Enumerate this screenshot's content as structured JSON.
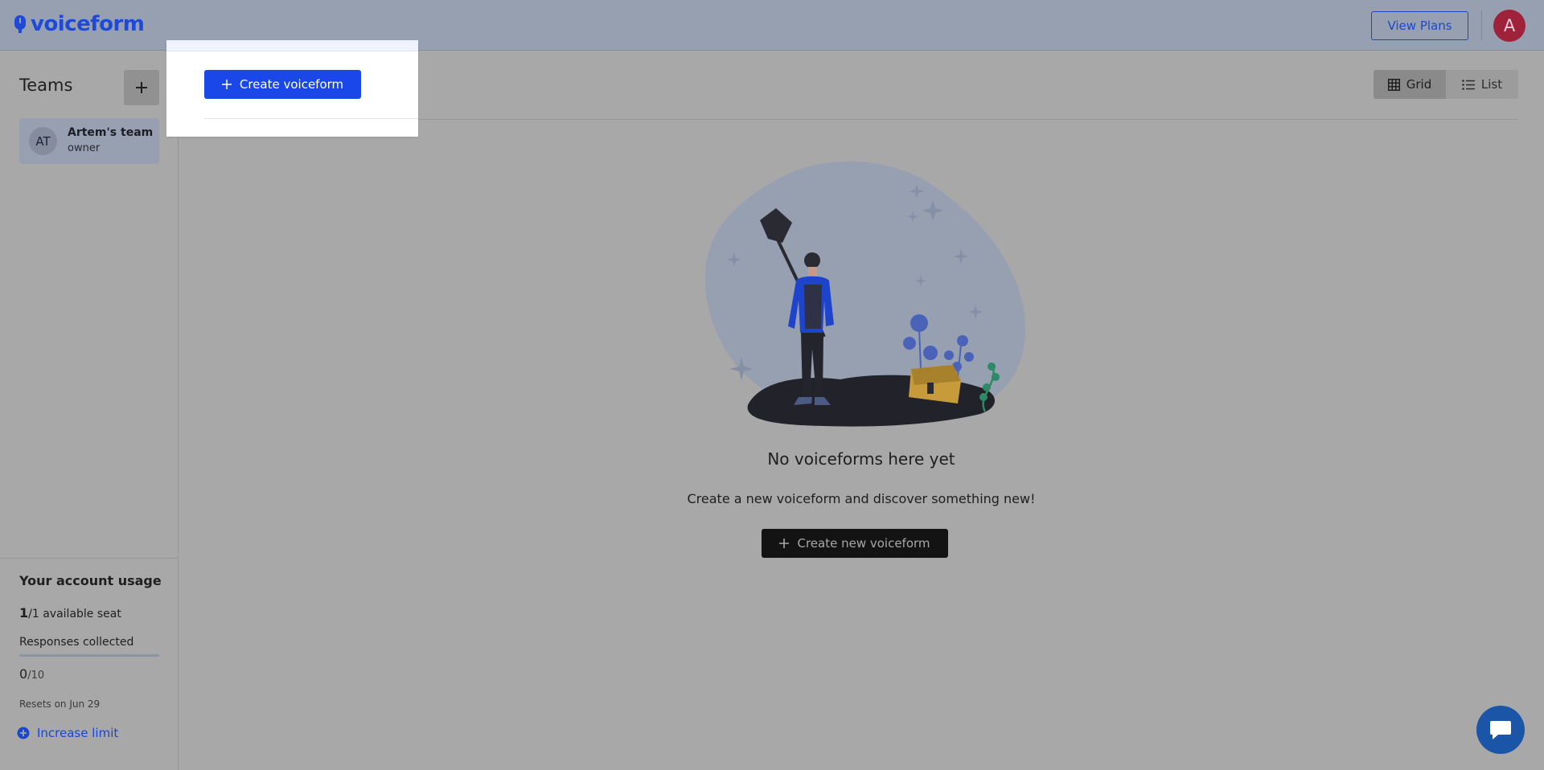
{
  "header": {
    "logo_text": "voiceform",
    "view_plans_label": "View Plans",
    "avatar_initial": "A"
  },
  "sidebar": {
    "teams_title": "Teams",
    "teams": [
      {
        "initials": "AT",
        "name": "Artem's team",
        "role": "owner"
      }
    ],
    "usage": {
      "title": "Your account usage",
      "seats_used": "1",
      "seats_total": "/1",
      "seats_label": "available seat",
      "responses_label": "Responses collected",
      "responses_used": "0",
      "responses_total": "/10",
      "responses_progress": 0,
      "resets_text": "Resets on Jun 29",
      "increase_label": "Increase limit"
    }
  },
  "main": {
    "view_toggle": {
      "grid_label": "Grid",
      "list_label": "List",
      "active": "grid"
    },
    "empty_state": {
      "title": "No voiceforms here yet",
      "subtitle": "Create a new voiceform and discover something new!",
      "button_label": "Create new voiceform"
    }
  },
  "popover": {
    "create_label": "Create voiceform"
  },
  "colors": {
    "brand_blue": "#1a47e8",
    "header_bg": "#97a0b1",
    "overlay_bg": "#a8a8a8",
    "avatar_bg": "#a0213a",
    "chat_bg": "#1a55a8"
  },
  "icons": [
    "mic-logo-icon",
    "plus-icon",
    "grid-icon",
    "list-icon",
    "add-circle-icon",
    "chat-icon"
  ]
}
